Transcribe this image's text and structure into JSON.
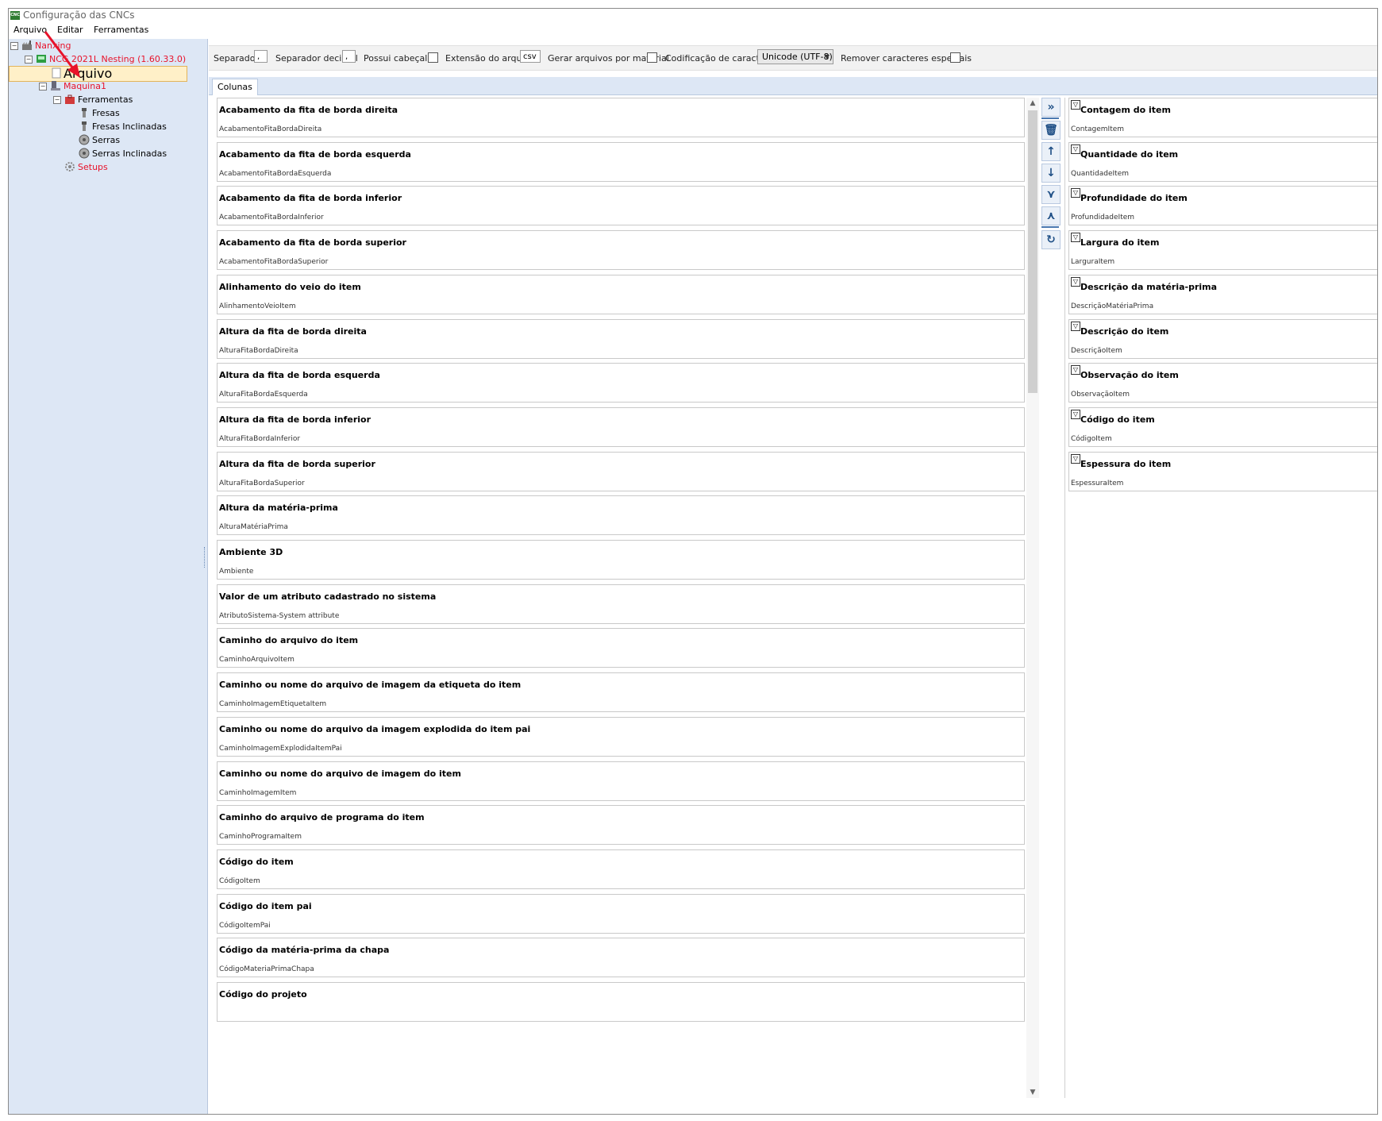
{
  "window": {
    "title": "Configuração das CNCs",
    "app_icon_text": "CNC"
  },
  "menu": [
    "Arquivo",
    "Editar",
    "Ferramentas"
  ],
  "tree": {
    "root": {
      "label": "Nanxing",
      "icon": "factory-icon"
    },
    "machine_config": {
      "label": "NCG 2021L Nesting (1.60.33.0)",
      "icon": "cnc-icon"
    },
    "selected_item": {
      "label": "Arquivo",
      "icon": "document-icon"
    },
    "machine": {
      "label": "Maquina1",
      "icon": "machine-icon"
    },
    "tools": {
      "label": "Ferramentas",
      "icon": "toolbox-icon"
    },
    "tool_items": [
      {
        "label": "Fresas",
        "icon": "mill-bit-icon"
      },
      {
        "label": "Fresas Inclinadas",
        "icon": "mill-bit-icon"
      },
      {
        "label": "Serras",
        "icon": "saw-blade-icon"
      },
      {
        "label": "Serras Inclinadas",
        "icon": "saw-blade-icon"
      }
    ],
    "setups": {
      "label": "Setups",
      "icon": "gear-icon"
    }
  },
  "options": {
    "separator_label": "Separador",
    "separator_value": ",",
    "decimal_separator_label": "Separador decimal",
    "decimal_separator_value": ",",
    "has_header_label": "Possui cabeçalho",
    "has_header_checked": false,
    "extension_label": "Extensão do arquivo",
    "extension_value": "csv",
    "per_material_label": "Gerar arquivos por material",
    "per_material_checked": false,
    "encoding_label": "Codificação de caracteres",
    "encoding_value": "Unicode (UTF-8)",
    "remove_special_label": "Remover caracteres especiais",
    "remove_special_checked": false
  },
  "tab": {
    "label": "Colunas"
  },
  "available_columns": [
    {
      "title": "Acabamento da fita de borda direita",
      "key": "AcabamentoFitaBordaDireita"
    },
    {
      "title": "Acabamento da fita de borda esquerda",
      "key": "AcabamentoFitaBordaEsquerda"
    },
    {
      "title": "Acabamento da fita de borda inferior",
      "key": "AcabamentoFitaBordaInferior"
    },
    {
      "title": "Acabamento da fita de borda superior",
      "key": "AcabamentoFitaBordaSuperior"
    },
    {
      "title": "Alinhamento do veio do item",
      "key": "AlinhamentoVeioItem"
    },
    {
      "title": "Altura da fita de borda direita",
      "key": "AlturaFitaBordaDireita"
    },
    {
      "title": "Altura da fita de borda esquerda",
      "key": "AlturaFitaBordaEsquerda"
    },
    {
      "title": "Altura da fita de borda inferior",
      "key": "AlturaFitaBordaInferior"
    },
    {
      "title": "Altura da fita de borda superior",
      "key": "AlturaFitaBordaSuperior"
    },
    {
      "title": "Altura da matéria-prima",
      "key": "AlturaMatériaPrima"
    },
    {
      "title": "Ambiente 3D",
      "key": "Ambiente"
    },
    {
      "title": "Valor de um atributo cadastrado no sistema",
      "key": "AtributoSistema-System attribute"
    },
    {
      "title": "Caminho do arquivo do item",
      "key": "CaminhoArquivoItem"
    },
    {
      "title": "Caminho ou nome do arquivo de imagem da etiqueta do item",
      "key": "CaminhoImagemEtiquetaItem"
    },
    {
      "title": "Caminho ou nome do arquivo da imagem explodida do item pai",
      "key": "CaminhoImagemExplodidaItemPai"
    },
    {
      "title": "Caminho ou nome do arquivo de imagem do item",
      "key": "CaminhoImagemItem"
    },
    {
      "title": "Caminho do arquivo de programa do item",
      "key": "CaminhoProgramaItem"
    },
    {
      "title": "Código do item",
      "key": "CódigoItem"
    },
    {
      "title": "Código do item pai",
      "key": "CódigoItemPai"
    },
    {
      "title": "Código da matéria-prima da chapa",
      "key": "CódigoMateriaPrimaChapa"
    },
    {
      "title": "Código do projeto",
      "key": ""
    }
  ],
  "selected_columns": [
    {
      "title": "Contagem do item",
      "key": "ContagemItem"
    },
    {
      "title": "Quantidade do item",
      "key": "QuantidadeItem"
    },
    {
      "title": "Profundidade do item",
      "key": "ProfundidadeItem"
    },
    {
      "title": "Largura do item",
      "key": "LarguraItem"
    },
    {
      "title": "Descrição da matéria-prima",
      "key": "DescriçãoMatériaPrima"
    },
    {
      "title": "Descrição do item",
      "key": "DescriçãoItem"
    },
    {
      "title": "Observação do item",
      "key": "ObservaçãoItem"
    },
    {
      "title": "Código do item",
      "key": "CódigoItem"
    },
    {
      "title": "Espessura do item",
      "key": "EspessuraItem"
    }
  ],
  "toolbar_icons": [
    "move-right-icon",
    "delete-icon",
    "move-up-icon",
    "move-down-icon",
    "merge-icon",
    "split-icon",
    "refresh-icon"
  ],
  "colors": {
    "tree_bg": "#dde7f5",
    "red_label": "#e8132b",
    "selection": "#fff0c8",
    "annotation_arrow": "#e8132b"
  }
}
